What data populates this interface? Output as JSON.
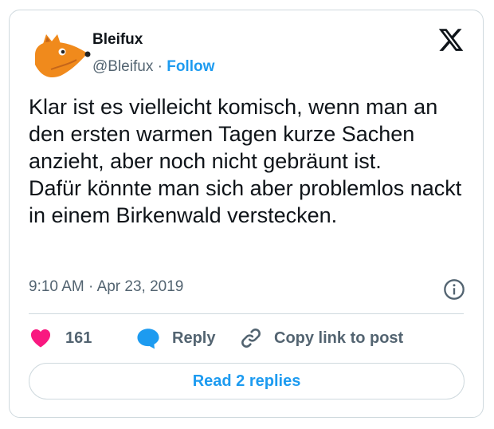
{
  "author": {
    "name": "Bleifux",
    "handle": "@Bleifux",
    "separator": " · ",
    "follow_label": "Follow"
  },
  "tweet": {
    "lines": [
      "Klar ist es vielleicht komisch, wenn man an den ersten warmen Tagen kurze Sachen anzieht, aber noch nicht gebräunt ist.",
      "Dafür könnte man sich aber problemlos nackt in einem Birkenwald verstecken."
    ],
    "time": "9:10 AM",
    "date_separator": " · ",
    "date": "Apr 23, 2019"
  },
  "actions": {
    "like_count": "161",
    "reply_label": "Reply",
    "copy_link_label": "Copy link to post"
  },
  "read_replies_label": "Read 2 replies",
  "icons": {
    "avatar": "fox-avatar",
    "brand": "x-logo-icon",
    "info": "info-icon",
    "like": "heart-icon",
    "reply": "speech-bubble-icon",
    "copy": "link-icon"
  },
  "colors": {
    "accent": "#1d9bf0",
    "like": "#f91880",
    "text": "#0f1419",
    "muted": "#536471",
    "border": "#cfd9de",
    "avatar": "#f08a1c"
  }
}
